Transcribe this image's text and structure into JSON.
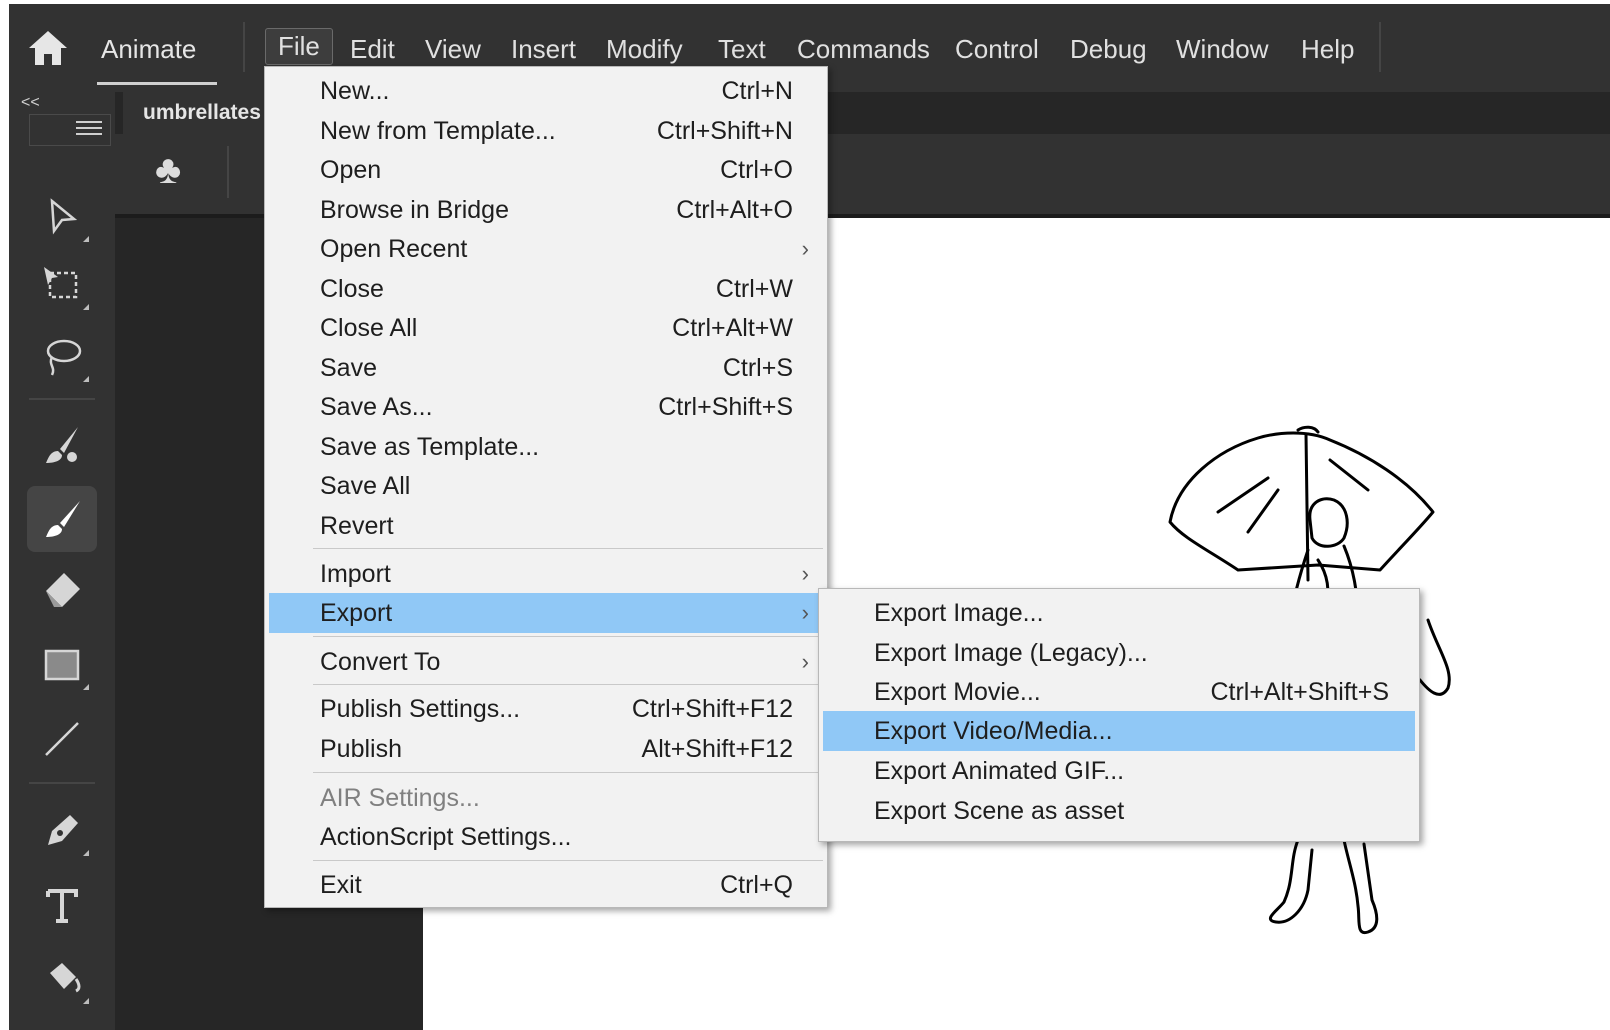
{
  "colors": {
    "menubar_bg": "#323232",
    "menu_bg": "#f2f2f2",
    "highlight": "#90c8f6",
    "stage_bg": "#ffffff"
  },
  "app": {
    "name": "Animate",
    "home_icon": "home-icon"
  },
  "menubar": {
    "items": [
      "File",
      "Edit",
      "View",
      "Insert",
      "Modify",
      "Text",
      "Commands",
      "Control",
      "Debug",
      "Window",
      "Help"
    ]
  },
  "toolbar": {
    "collapse": "<<",
    "tools": [
      "subselection-icon",
      "free-transform-icon",
      "lasso-icon",
      "paint-brush-icon",
      "brush-icon",
      "eraser-icon",
      "rectangle-icon",
      "line-icon",
      "pen-icon",
      "text-icon",
      "paint-bucket-icon"
    ],
    "selected_tool": "brush-icon"
  },
  "document": {
    "tab_title": "umbrellates",
    "scene_icon": "club-icon"
  },
  "file_menu": {
    "items": [
      {
        "label": "New...",
        "shortcut": "Ctrl+N"
      },
      {
        "label": "New from Template...",
        "shortcut": "Ctrl+Shift+N"
      },
      {
        "label": "Open",
        "shortcut": "Ctrl+O"
      },
      {
        "label": "Browse in Bridge",
        "shortcut": "Ctrl+Alt+O"
      },
      {
        "label": "Open Recent",
        "shortcut": ""
      },
      {
        "label": "Close",
        "shortcut": "Ctrl+W"
      },
      {
        "label": "Close All",
        "shortcut": "Ctrl+Alt+W"
      },
      {
        "label": "Save",
        "shortcut": "Ctrl+S"
      },
      {
        "label": "Save As...",
        "shortcut": "Ctrl+Shift+S"
      },
      {
        "label": "Save as Template...",
        "shortcut": ""
      },
      {
        "label": "Save All",
        "shortcut": ""
      },
      {
        "label": "Revert",
        "shortcut": ""
      },
      {
        "label": "Import",
        "shortcut": ""
      },
      {
        "label": "Export",
        "shortcut": ""
      },
      {
        "label": "Convert To",
        "shortcut": ""
      },
      {
        "label": "Publish Settings...",
        "shortcut": "Ctrl+Shift+F12"
      },
      {
        "label": "Publish",
        "shortcut": "Alt+Shift+F12"
      },
      {
        "label": "AIR Settings...",
        "shortcut": ""
      },
      {
        "label": "ActionScript Settings...",
        "shortcut": ""
      },
      {
        "label": "Exit",
        "shortcut": "Ctrl+Q"
      }
    ],
    "submenu_arrow": "›"
  },
  "export_menu": {
    "items": [
      {
        "label": "Export Image...",
        "shortcut": ""
      },
      {
        "label": "Export Image (Legacy)...",
        "shortcut": ""
      },
      {
        "label": "Export Movie...",
        "shortcut": "Ctrl+Alt+Shift+S"
      },
      {
        "label": "Export Video/Media...",
        "shortcut": ""
      },
      {
        "label": "Export Animated GIF...",
        "shortcut": ""
      },
      {
        "label": "Export Scene as asset",
        "shortcut": ""
      }
    ]
  }
}
